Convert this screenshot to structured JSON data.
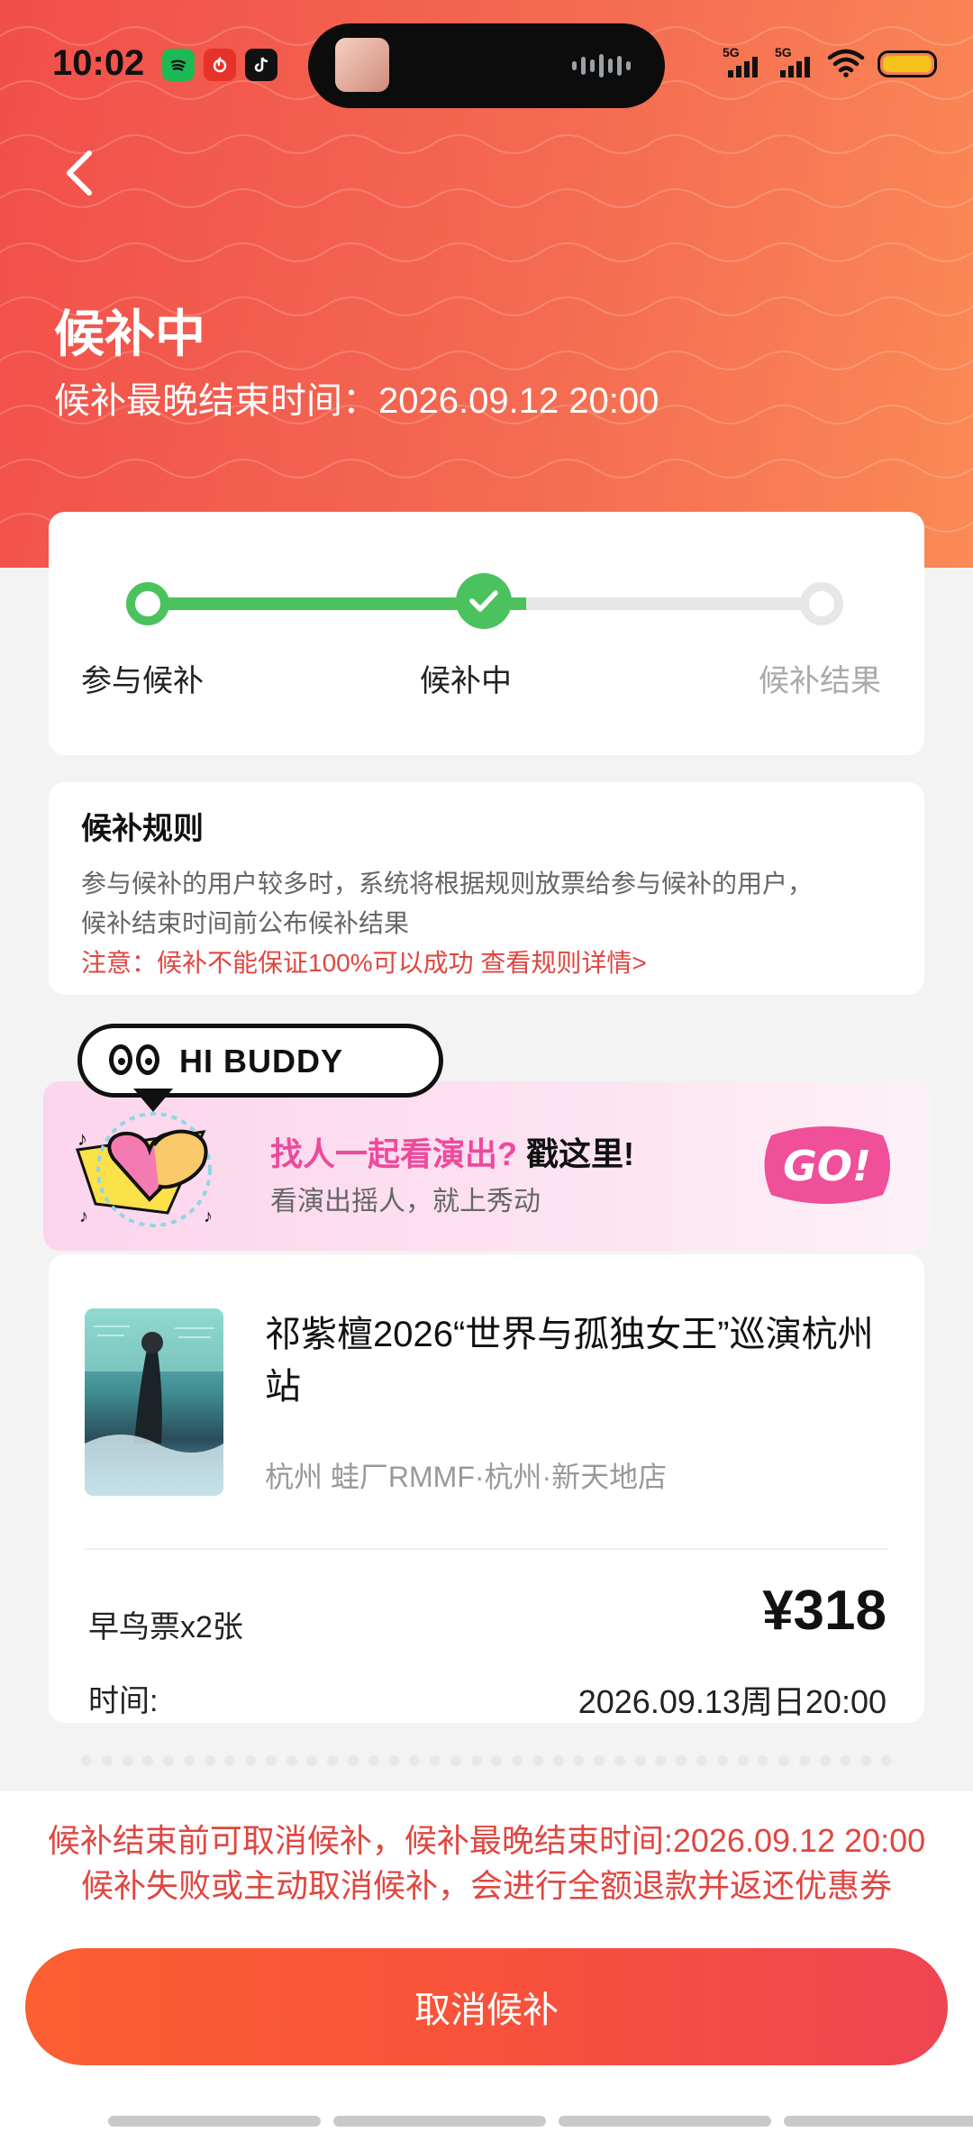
{
  "status_bar": {
    "time": "10:02",
    "network_1": "5G",
    "network_2": "5G",
    "apps": [
      "spotify-icon",
      "netease-music-icon",
      "tiktok-icon"
    ]
  },
  "header": {
    "title": "候补中",
    "deadline": "候补最晚结束时间：2026.09.12 20:00"
  },
  "steps": [
    {
      "label": "参与候补",
      "state": "done"
    },
    {
      "label": "候补中",
      "state": "current"
    },
    {
      "label": "候补结果",
      "state": "pending"
    }
  ],
  "rules": {
    "title": "候补规则",
    "line1": "参与候补的用户较多时，系统将根据规则放票给参与候补的用户，",
    "line2": "候补结束时间前公布候补结果",
    "warning": "注意：候补不能保证100%可以成功 查看规则详情>"
  },
  "promo": {
    "bubble": "HI BUDDY",
    "title_pink": "找人一起看演出?",
    "title_dark": " 戳这里!",
    "subtitle": "看演出摇人，就上秀动",
    "go": "GO!"
  },
  "ticket": {
    "event_name": "祁紫檀2026“世界与孤独女王”巡演杭州站",
    "venue": "杭州 蛙厂RMMF·杭州·新天地店",
    "ticket_type": "早鸟票x2张",
    "price": "¥318",
    "time_label": "时间:",
    "time_value": "2026.09.13周日20:00"
  },
  "bottom": {
    "notice_line1": "候补结束前可取消候补，候补最晚结束时间:2026.09.12 20:00",
    "notice_line2": "候补失败或主动取消候补，会进行全额退款并返还优惠券",
    "cancel_button": "取消候补"
  },
  "colors": {
    "accent_red": "#e04640",
    "progress_green": "#4cc25f",
    "header_gradient_start": "#f14f4a",
    "header_gradient_end": "#fb8a55"
  }
}
